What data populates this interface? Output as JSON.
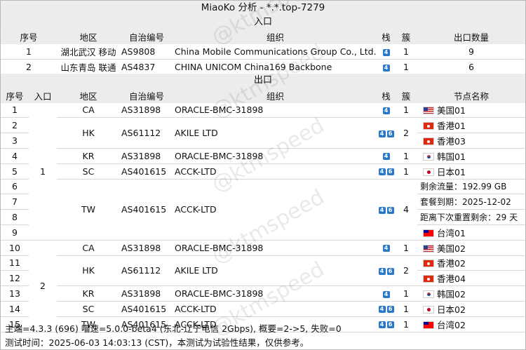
{
  "title": "MiaoKo 分析 - *.*.top-7279",
  "entry_section": {
    "heading": "入口",
    "headers": [
      "序号",
      "地区",
      "自治编号",
      "组织",
      "栈",
      "簇",
      "出口数量"
    ],
    "rows": [
      {
        "idx": "1",
        "region": "湖北武汉 移动",
        "asn": "AS9808",
        "org": "China Mobile Communications Group Co., Ltd.",
        "stack": [
          "4"
        ],
        "cluster": "1",
        "exits": "9"
      },
      {
        "idx": "2",
        "region": "山东青岛 联通",
        "asn": "AS4837",
        "org": "CHINA UNICOM China169 Backbone",
        "stack": [
          "4"
        ],
        "cluster": "1",
        "exits": "6"
      }
    ]
  },
  "exit_section": {
    "heading": "出口",
    "headers": [
      "序号",
      "入口",
      "地区",
      "自治编号",
      "组织",
      "栈",
      "簇",
      "节点名称"
    ],
    "rows": [
      {
        "idx": "1",
        "entry": "1",
        "region": "CA",
        "asn": "AS31898",
        "org": "ORACLE-BMC-31898",
        "stack": [
          "4"
        ],
        "cluster": "1",
        "flag": "US",
        "node": "美国01"
      },
      {
        "idx": "2",
        "entry": "1",
        "region": "HK",
        "asn": "AS61112",
        "org": "AKILE LTD",
        "stack": [
          "4",
          "6"
        ],
        "cluster": "2",
        "flag": "HK",
        "node": "香港01"
      },
      {
        "idx": "3",
        "entry": "1",
        "region": "HK",
        "asn": "AS61112",
        "org": "AKILE LTD",
        "stack": [
          "4",
          "6"
        ],
        "cluster": "2",
        "flag": "HK",
        "node": "香港03"
      },
      {
        "idx": "4",
        "entry": "1",
        "region": "KR",
        "asn": "AS31898",
        "org": "ORACLE-BMC-31898",
        "stack": [
          "4"
        ],
        "cluster": "1",
        "flag": "KR",
        "node": "韩国01"
      },
      {
        "idx": "5",
        "entry": "1",
        "region": "SC",
        "asn": "AS401615",
        "org": "ACCK-LTD",
        "stack": [
          "4",
          "6"
        ],
        "cluster": "1",
        "flag": "JP",
        "node": "日本01"
      },
      {
        "idx": "6",
        "entry": "1",
        "region": "TW",
        "asn": "AS401615",
        "org": "ACCK-LTD",
        "stack": [
          "4",
          "6"
        ],
        "cluster": "4",
        "flag": "",
        "node": "剩余流量：192.99 GB"
      },
      {
        "idx": "7",
        "entry": "1",
        "region": "TW",
        "asn": "AS401615",
        "org": "ACCK-LTD",
        "stack": [
          "4",
          "6"
        ],
        "cluster": "4",
        "flag": "",
        "node": "套餐到期：2025-12-02"
      },
      {
        "idx": "8",
        "entry": "1",
        "region": "TW",
        "asn": "AS401615",
        "org": "ACCK-LTD",
        "stack": [
          "4",
          "6"
        ],
        "cluster": "4",
        "flag": "",
        "node": "距离下次重置剩余：29 天"
      },
      {
        "idx": "9",
        "entry": "1",
        "region": "TW",
        "asn": "AS401615",
        "org": "ACCK-LTD",
        "stack": [
          "4",
          "6"
        ],
        "cluster": "4",
        "flag": "TW",
        "node": "台湾01"
      },
      {
        "idx": "10",
        "entry": "2",
        "region": "CA",
        "asn": "AS31898",
        "org": "ORACLE-BMC-31898",
        "stack": [
          "4"
        ],
        "cluster": "1",
        "flag": "US",
        "node": "美国02"
      },
      {
        "idx": "11",
        "entry": "2",
        "region": "HK",
        "asn": "AS61112",
        "org": "AKILE LTD",
        "stack": [
          "4",
          "6"
        ],
        "cluster": "2",
        "flag": "HK",
        "node": "香港02"
      },
      {
        "idx": "12",
        "entry": "2",
        "region": "HK",
        "asn": "AS61112",
        "org": "AKILE LTD",
        "stack": [
          "4",
          "6"
        ],
        "cluster": "2",
        "flag": "HK",
        "node": "香港04"
      },
      {
        "idx": "13",
        "entry": "2",
        "region": "KR",
        "asn": "AS31898",
        "org": "ORACLE-BMC-31898",
        "stack": [
          "4"
        ],
        "cluster": "1",
        "flag": "KR",
        "node": "韩国02"
      },
      {
        "idx": "14",
        "entry": "2",
        "region": "SC",
        "asn": "AS401615",
        "org": "ACCK-LTD",
        "stack": [
          "4",
          "6"
        ],
        "cluster": "1",
        "flag": "JP",
        "node": "日本02"
      },
      {
        "idx": "15",
        "entry": "2",
        "region": "TW",
        "asn": "AS401615",
        "org": "ACCK-LTD",
        "stack": [
          "4",
          "6"
        ],
        "cluster": "1",
        "flag": "TW",
        "node": "台湾02"
      }
    ]
  },
  "footer": {
    "line1": "主端=4.3.3 (696) 喵速=5.0.0-beta4 (东北-辽宁电信 2Gbps), 概要=2->5, 失败=0",
    "line2": "测试时间：2025-06-03 14:03:13 (CST)，本测试为试验性结果，仅供参考。"
  },
  "watermark": "@ktmspeed",
  "colors": {
    "badge": "#2a78c8",
    "header_bg": "#ececec",
    "border": "#d8d8d8"
  }
}
